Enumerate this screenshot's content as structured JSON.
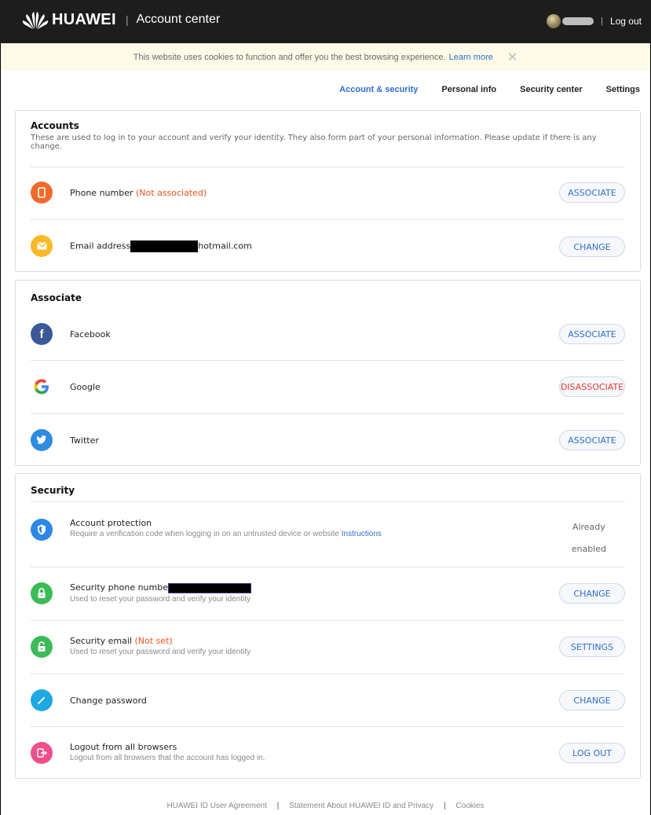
{
  "header": {
    "brand": "HUAWEI",
    "separator": "|",
    "title": "Account center",
    "logout": "Log out"
  },
  "cookie": {
    "text": "This website uses cookies to function and offer you the best browsing experience.",
    "learn_more": "Learn more",
    "close": "✕"
  },
  "tabs": [
    "Account & security",
    "Personal info",
    "Security center",
    "Settings"
  ],
  "accounts": {
    "title": "Accounts",
    "description": "These are used to log in to your account and verify your identity. They also form part of your personal information. Please update if there is any change.",
    "phone_label": "Phone number",
    "phone_status": "(Not associated)",
    "phone_button": "ASSOCIATE",
    "email_label": "Email address",
    "email_suffix": "hotmail.com",
    "email_button": "CHANGE"
  },
  "associate": {
    "title": "Associate",
    "facebook_label": "Facebook",
    "facebook_button": "ASSOCIATE",
    "google_label": "Google",
    "google_button": "DISASSOCIATE",
    "twitter_label": "Twitter",
    "twitter_button": "ASSOCIATE"
  },
  "security": {
    "title": "Security",
    "protection_label": "Account protection",
    "protection_sub": "Require a verification code when logging in on an untrusted device or website",
    "protection_link": "Instructions",
    "protection_status_1": "Already",
    "protection_status_2": "enabled",
    "sec_phone_label": "Security phone numbe",
    "sec_phone_sub": "Used to reset your password and verify your identity",
    "sec_phone_button": "CHANGE",
    "sec_email_label": "Security email",
    "sec_email_status": "(Not set)",
    "sec_email_sub": "Used to reset your password and verify your identity",
    "sec_email_button": "SETTINGS",
    "password_label": "Change password",
    "password_button": "CHANGE",
    "logout_label": "Logout from all browsers",
    "logout_sub": "Logout from all browsers that the account has logged in.",
    "logout_button": "LOG OUT"
  },
  "footer": {
    "agreement": "HUAWEI ID User Agreement",
    "privacy": "Statement About HUAWEI ID and Privacy",
    "cookies": "Cookies",
    "separator": "|"
  },
  "colors": {
    "accent": "#2f6ed1",
    "warning": "#e9541c",
    "danger": "#e23b2e",
    "phone_icon": "#f06a2c",
    "email_icon": "#f7b928",
    "facebook_icon": "#3b5998",
    "twitter_icon": "#2f8be0",
    "protection_icon": "#2e86e6",
    "lock_icon": "#3dbb58",
    "password_icon": "#1fa9e2",
    "logout_icon": "#ee4f8a"
  }
}
